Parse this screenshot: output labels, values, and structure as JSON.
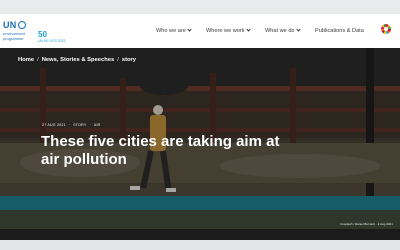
{
  "header": {
    "logo": {
      "un": "UN",
      "line1": "environment",
      "line2": "programme",
      "anniversary": "50",
      "anniversary_sub": "UN 50 1972 2022"
    },
    "nav": [
      {
        "label": "Who we are",
        "has_dropdown": true
      },
      {
        "label": "Where we work",
        "has_dropdown": true
      },
      {
        "label": "What we do",
        "has_dropdown": true
      },
      {
        "label": "Publications & Data",
        "has_dropdown": false
      }
    ],
    "sdg_icon": "sdg-color-wheel-icon"
  },
  "breadcrumb": {
    "items": [
      "Home",
      "News, Stories & Speeches",
      "story"
    ],
    "separator": "/"
  },
  "article": {
    "date": "27 AUG 2021",
    "type": "STORY",
    "topic": "AIR",
    "title_line1": "These five cities are taking aim at",
    "title_line2": "air pollution",
    "photo_credit": "Unsplash / Daniel Bernard · 2 Aug 2021"
  }
}
